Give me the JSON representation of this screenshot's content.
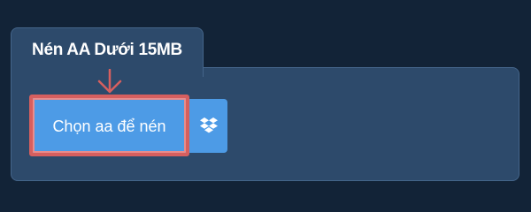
{
  "upload_card": {
    "tab_title": "Nén AA Dưới 15MB",
    "choose_file_label": "Chọn aa để nén"
  },
  "icons": {
    "arrow": "arrow-down-icon",
    "dropbox": "dropbox-icon"
  },
  "colors": {
    "page_background": "#122337",
    "panel_background": "#2d4a6b",
    "button_blue": "#4d9be6",
    "highlight_red": "#d65f5f"
  }
}
